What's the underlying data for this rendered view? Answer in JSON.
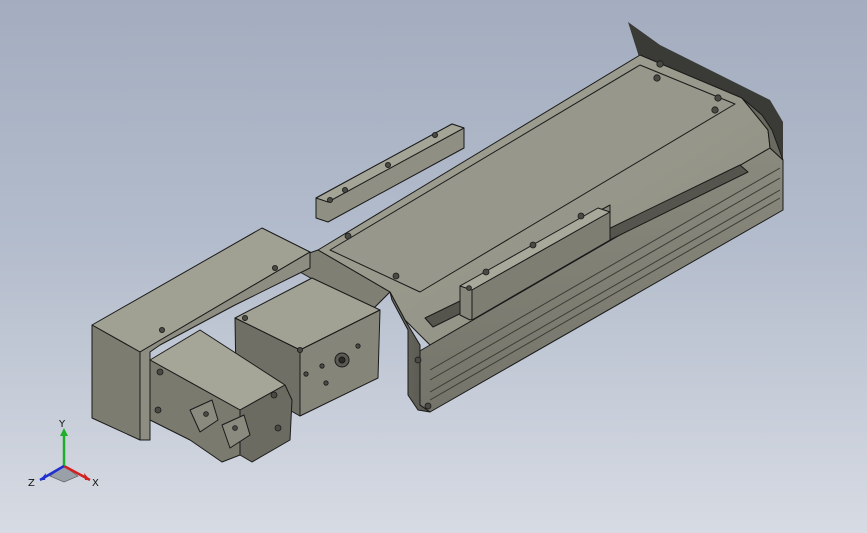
{
  "viewport": {
    "background_top": "#a3adbf",
    "background_bottom": "#d7dbe3",
    "model_colors": {
      "body_face": "#8a8a7e",
      "body_top": "#9c9c90",
      "body_dark": "#5e5e56",
      "edge": "#1a1a1a"
    }
  },
  "triad": {
    "x_label": "X",
    "y_label": "Y",
    "z_label": "Z",
    "x_color": "#d22020",
    "y_color": "#1fae2a",
    "z_color": "#2030d0"
  }
}
